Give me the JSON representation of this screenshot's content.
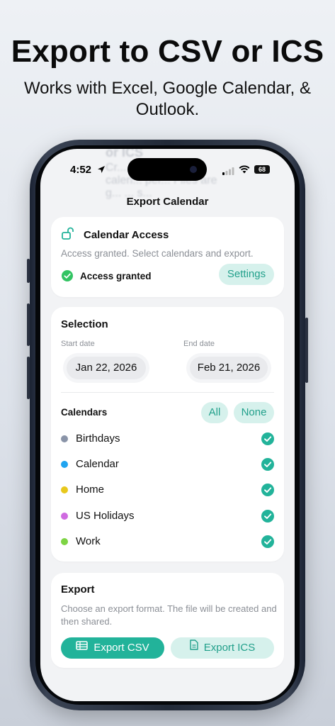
{
  "promo": {
    "headline": "Export to CSV or ICS",
    "subline_1": "Works with Excel, Google Calendar, &",
    "subline_2": "Outlook."
  },
  "background_ghost": {
    "line_1": "or ICS",
    "line_2": "Cr...",
    "line_3": "calen... per... Files are",
    "line_4": "g... ... s..."
  },
  "status_bar": {
    "time": "4:52",
    "battery": "68"
  },
  "nav": {
    "title": "Export Calendar"
  },
  "access_card": {
    "title": "Calendar Access",
    "description": "Access granted. Select calendars and export.",
    "status_label": "Access granted",
    "settings_label": "Settings"
  },
  "selection_card": {
    "title": "Selection",
    "start_label": "Start date",
    "start_value": "Jan 22, 2026",
    "end_label": "End date",
    "end_value": "Feb 21, 2026",
    "calendars_label": "Calendars",
    "all_label": "All",
    "none_label": "None",
    "calendars": [
      {
        "name": "Birthdays",
        "color": "#8a94a8",
        "selected": true
      },
      {
        "name": "Calendar",
        "color": "#1fa4f0",
        "selected": true
      },
      {
        "name": "Home",
        "color": "#e8c81c",
        "selected": true
      },
      {
        "name": "US Holidays",
        "color": "#cf6ae0",
        "selected": true
      },
      {
        "name": "Work",
        "color": "#7ed444",
        "selected": true
      }
    ]
  },
  "export_card": {
    "title": "Export",
    "description": "Choose an export format. The file will be created and then shared.",
    "csv_label": "Export CSV",
    "ics_label": "Export ICS"
  },
  "colors": {
    "accent": "#22b39a",
    "accent_soft": "#d6f1ec",
    "accent_text": "#22a08b"
  }
}
